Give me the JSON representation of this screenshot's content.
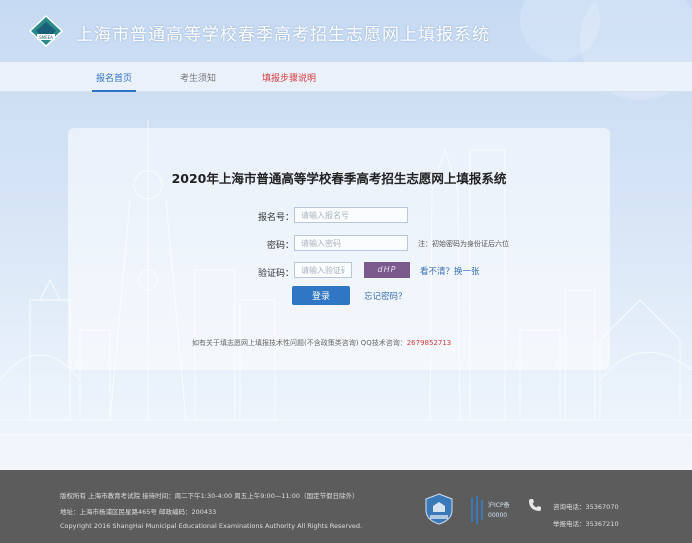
{
  "header": {
    "title": "上海市普通高等学校春季高考招生志愿网上填报系统",
    "logo_icon": "exam-authority-logo-icon"
  },
  "nav": {
    "items": [
      {
        "label": "报名首页",
        "state": "active"
      },
      {
        "label": "考生须知",
        "state": "normal"
      },
      {
        "label": "填报步骤说明",
        "state": "red"
      }
    ]
  },
  "login": {
    "title": "2020年上海市普通高等学校春季高考招生志愿网上填报系统",
    "reg_label": "报名号：",
    "reg_placeholder": "请输入报名号",
    "pwd_label": "密码：",
    "pwd_placeholder": "请输入密码",
    "pwd_hint": "注：初始密码为身份证后六位",
    "captcha_label": "验证码：",
    "captcha_placeholder": "请输入验证码",
    "captcha_text": "dHP",
    "captcha_refresh": "看不清？换一张",
    "login_button": "登录",
    "forgot": "忘记密码？",
    "support_text": "如有关于填志愿网上填报技术性问题(不含政策类咨询)  QQ技术咨询：",
    "support_qq": "2679852713"
  },
  "footer": {
    "line1": "版权所有  上海市教育考试院 接待时间：周二下午1:30-4:00 周五上午9:00—11:00（国定节假日除外）",
    "line2": "地址：上海市杨浦区民星路465号 邮政编码：200433",
    "line3": "Copyright 2016 ShangHai Municipal Educational Examinations Authority All Rights Reserved.",
    "badge1_icon": "police-badge-icon",
    "badge2_label": "沪ICP备",
    "badge2_sub": "00000",
    "phone_icon": "phone-icon",
    "consult_phone": "咨询电话：35367070",
    "complaint_phone": "举报电话：35367210"
  },
  "colors": {
    "accent": "#2f73c6",
    "red": "#d63b3b",
    "footer_bg": "#5c5c5c"
  }
}
